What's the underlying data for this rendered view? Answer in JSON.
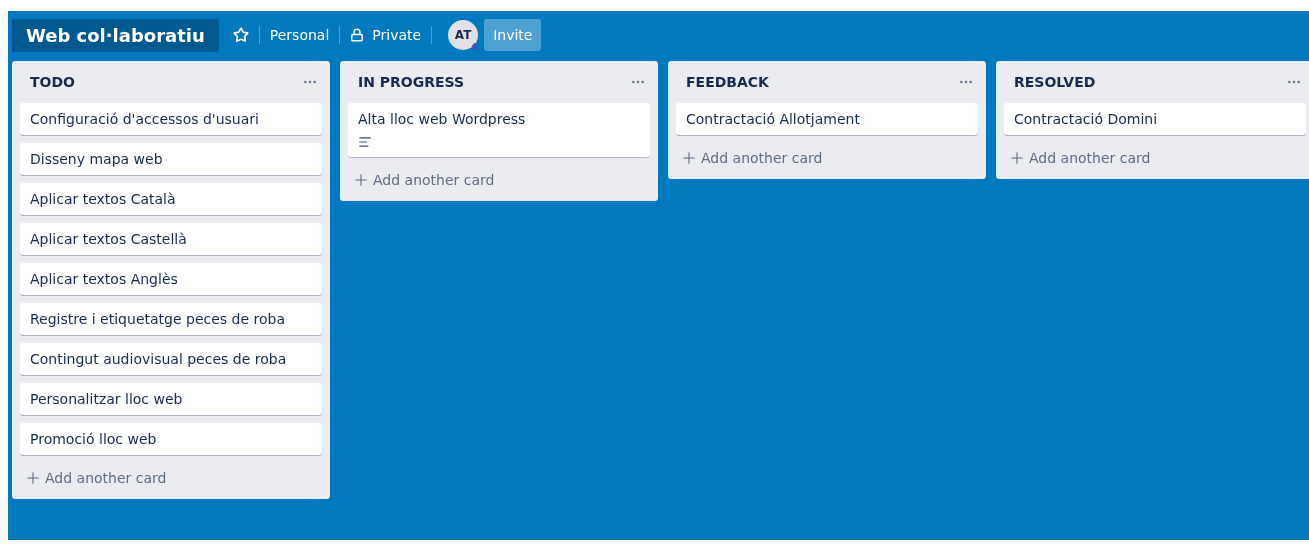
{
  "board": {
    "title": "Web col·laboratiu",
    "starred": false,
    "team": "Personal",
    "visibility": "Private",
    "member_initials": "AT",
    "invite": "Invite"
  },
  "lists": [
    {
      "title": "TODO",
      "cards": [
        {
          "title": "Configuració d'accessos d'usuari",
          "has_description": false
        },
        {
          "title": "Disseny mapa web",
          "has_description": false
        },
        {
          "title": "Aplicar textos Català",
          "has_description": false
        },
        {
          "title": "Aplicar textos Castellà",
          "has_description": false
        },
        {
          "title": "Aplicar textos Anglès",
          "has_description": false
        },
        {
          "title": "Registre i etiquetatge peces de roba",
          "has_description": false
        },
        {
          "title": "Contingut audiovisual peces de roba",
          "has_description": false
        },
        {
          "title": "Personalitzar lloc web",
          "has_description": false
        },
        {
          "title": "Promoció lloc web",
          "has_description": false
        }
      ],
      "add_label": "Add another card"
    },
    {
      "title": "IN PROGRESS",
      "cards": [
        {
          "title": "Alta lloc web Wordpress",
          "has_description": true
        }
      ],
      "add_label": "Add another card"
    },
    {
      "title": "FEEDBACK",
      "cards": [
        {
          "title": "Contractació Allotjament",
          "has_description": false
        }
      ],
      "add_label": "Add another card"
    },
    {
      "title": "RESOLVED",
      "cards": [
        {
          "title": "Contractació Domini",
          "has_description": false
        }
      ],
      "add_label": "Add another card"
    }
  ]
}
